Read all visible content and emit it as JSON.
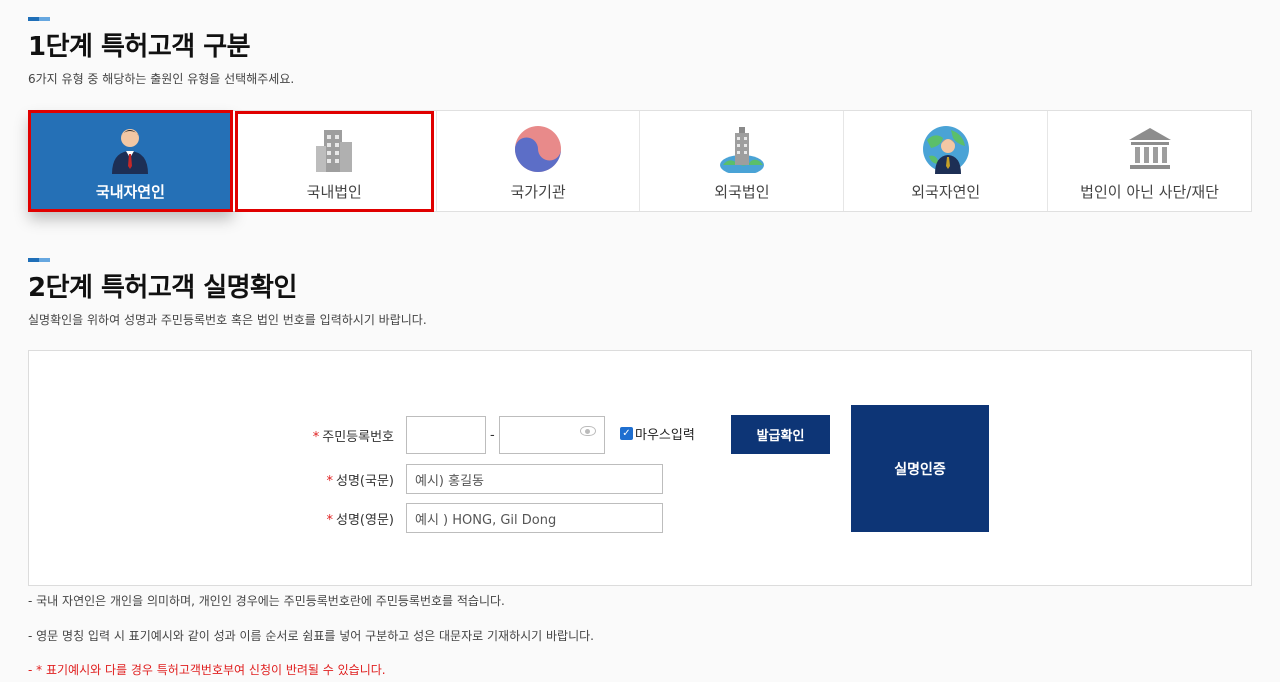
{
  "step1": {
    "title": "1단계 특허고객 구분",
    "desc": "6가지 유형 중 해당하는 출원인 유형을 선택해주세요.",
    "types": [
      {
        "label": "국내자연인",
        "icon": "person-icon"
      },
      {
        "label": "국내법인",
        "icon": "building-icon"
      },
      {
        "label": "국가기관",
        "icon": "taegeuk-icon"
      },
      {
        "label": "외국법인",
        "icon": "globe-building-icon"
      },
      {
        "label": "외국자연인",
        "icon": "globe-person-icon"
      },
      {
        "label": "법인이 아닌 사단/재단",
        "icon": "institution-icon"
      }
    ]
  },
  "step2": {
    "title": "2단계 특허고객 실명확인",
    "desc": "실명확인을 위하여 성명과 주민등록번호 혹은 법인 번호를 입력하시기 바랍니다.",
    "required_mark": "*",
    "rrn_label": "주민등록번호",
    "rrn_dash": "-",
    "mouse_input_label": "마우스입력",
    "name_kr_label": "성명(국문)",
    "name_kr_placeholder": "예시) 홍길동",
    "name_en_label": "성명(영문)",
    "name_en_placeholder": "예시 ) HONG, Gil Dong",
    "issue_button": "발급확인",
    "verify_button": "실명인증"
  },
  "notes": [
    "- 국내 자연인은 개인을 의미하며, 개인인 경우에는 주민등록번호란에 주민등록번호를 적습니다.",
    "- 영문 명칭 입력 시 표기예시와 같이 성과 이름 순서로 쉼표를 넣어 구분하고 성은 대문자로 기재하시기 바랍니다.",
    "- * 표기예시와 다를 경우 특허고객번호부여 신청이 반려될 수 있습니다."
  ],
  "colors": {
    "accent": "#2570b6",
    "navy_button": "#0d3576",
    "highlight": "#e00000",
    "warning": "#e02020"
  }
}
